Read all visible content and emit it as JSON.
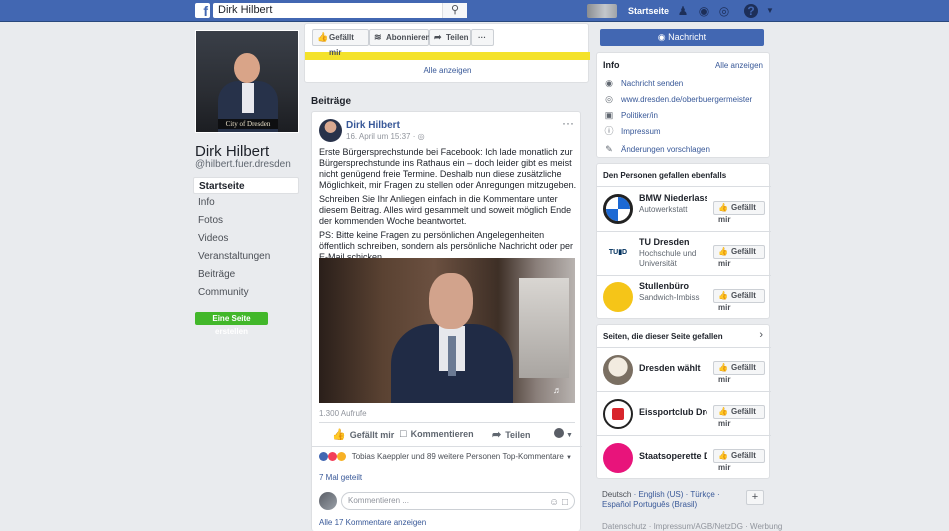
{
  "topbar": {
    "logo": "f",
    "search_value": "Dirk Hilbert",
    "home_label": "Startseite",
    "icons": [
      "search-icon",
      "friends-icon",
      "messenger-icon",
      "globe-icon",
      "help-icon",
      "chevron-down-icon"
    ]
  },
  "profile": {
    "sign_text": "City of Dresden",
    "name": "Dirk Hilbert",
    "handle": "@hilbert.fuer.dresden"
  },
  "nav": {
    "items": [
      "Startseite",
      "Info",
      "Fotos",
      "Videos",
      "Veranstaltungen",
      "Beiträge",
      "Community"
    ],
    "create_page": "Eine Seite erstellen"
  },
  "action_bar": {
    "like": "Gefällt mir",
    "subscribe": "Abonnieren",
    "share": "Teilen",
    "more": "···",
    "show_all": "Alle anzeigen"
  },
  "posts": {
    "heading": "Beiträge",
    "author": "Dirk Hilbert",
    "time": "16. April um 15:37 · ",
    "paragraphs": [
      "Erste Bürgersprechstunde bei Facebook: Ich lade monatlich zur Bürgersprechstunde ins Rathaus ein – doch leider gibt es meist nicht genügend freie Termine. Deshalb nun diese zusätzliche Möglichkeit, mir Fragen zu stellen oder Anregungen mitzugeben.",
      "Schreiben Sie Ihr Anliegen einfach in die Kommentare unter diesem Beitrag. Alles wird gesammelt und soweit möglich Ende der kommenden Woche beantwortet.",
      "PS: Bitte keine Fragen zu persönlichen Angelegenheiten öffentlich schreiben, sondern als persönliche Nachricht oder per E-Mail schicken."
    ],
    "views": "1.300 Aufrufe",
    "like": "Gefällt mir",
    "comment": "Kommentieren",
    "share": "Teilen",
    "reactions_text": "Tobias Kaeppler und 89 weitere Personen",
    "top_comments": "Top-Kommentare",
    "shares": "7 Mal geteilt",
    "comment_placeholder": "Kommentieren ...",
    "all_comments": "Alle 17 Kommentare anzeigen"
  },
  "sidebar": {
    "message_button": "Nachricht",
    "info": {
      "title": "Info",
      "show_all": "Alle anzeigen",
      "rows": [
        "Nachricht senden",
        "www.dresden.de/oberbuergermeister",
        "Politiker/in",
        "Impressum",
        "Änderungen vorschlagen"
      ]
    },
    "people": {
      "title": "Den Personen gefallen ebenfalls",
      "items": [
        {
          "name": "BMW Niederlassung",
          "sub": "Autowerkstatt",
          "logo_color": "#ffffff"
        },
        {
          "name": "TU Dresden",
          "sub": "Hochschule und Universität",
          "logo_color": "#ffffff"
        },
        {
          "name": "Stullenbüro",
          "sub": "Sandwich-Imbiss",
          "logo_color": "#f5c518"
        }
      ],
      "like": "Gefällt mir"
    },
    "liked": {
      "title": "Seiten, die dieser Seite gefallen",
      "items": [
        "Dresden wählt",
        "Eissportclub Dresden",
        "Staatsoperette Dresden"
      ],
      "like": "Gefällt mir"
    },
    "languages": {
      "current": "Deutsch",
      "others": [
        "English (US)",
        "Türkçe",
        "Español",
        "Português (Brasil)"
      ],
      "footer": "Datenschutz · Impressum/AGB/NetzDG · Werbung"
    }
  },
  "colors": {
    "brand": "#4267b2",
    "link": "#385898",
    "green": "#42b72a",
    "accent_yellow": "#f4e22a"
  }
}
